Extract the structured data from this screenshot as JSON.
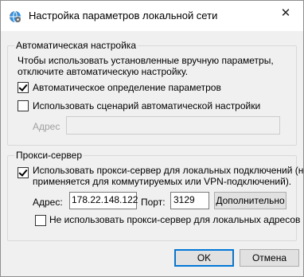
{
  "window": {
    "title": "Настройка параметров локальной сети",
    "close_symbol": "✕"
  },
  "auto": {
    "group_title": "Автоматическая настройка",
    "description_line1": "Чтобы использовать установленные вручную параметры,",
    "description_line2": "отключите автоматическую настройку.",
    "auto_detect_label": "Автоматическое определение параметров",
    "auto_detect_checked": true,
    "script_label": "Использовать сценарий автоматической настройки",
    "script_checked": false,
    "address_label": "Адрес",
    "address_value": ""
  },
  "proxy": {
    "group_title": "Прокси-сервер",
    "use_proxy_line1": "Использовать прокси-сервер для локальных подключений (не",
    "use_proxy_line2": "применяется для коммутируемых или VPN-подключений).",
    "use_proxy_checked": true,
    "address_label": "Адрес:",
    "address_value": "178.22.148.122",
    "port_label": "Порт:",
    "port_value": "3129",
    "advanced_button": "Дополнительно",
    "bypass_label": "Не использовать прокси-сервер для локальных адресов",
    "bypass_checked": false
  },
  "buttons": {
    "ok": "OK",
    "cancel": "Отмена"
  },
  "colors": {
    "accent": "#0078d7",
    "dialog_bg": "#f0f0f0"
  }
}
